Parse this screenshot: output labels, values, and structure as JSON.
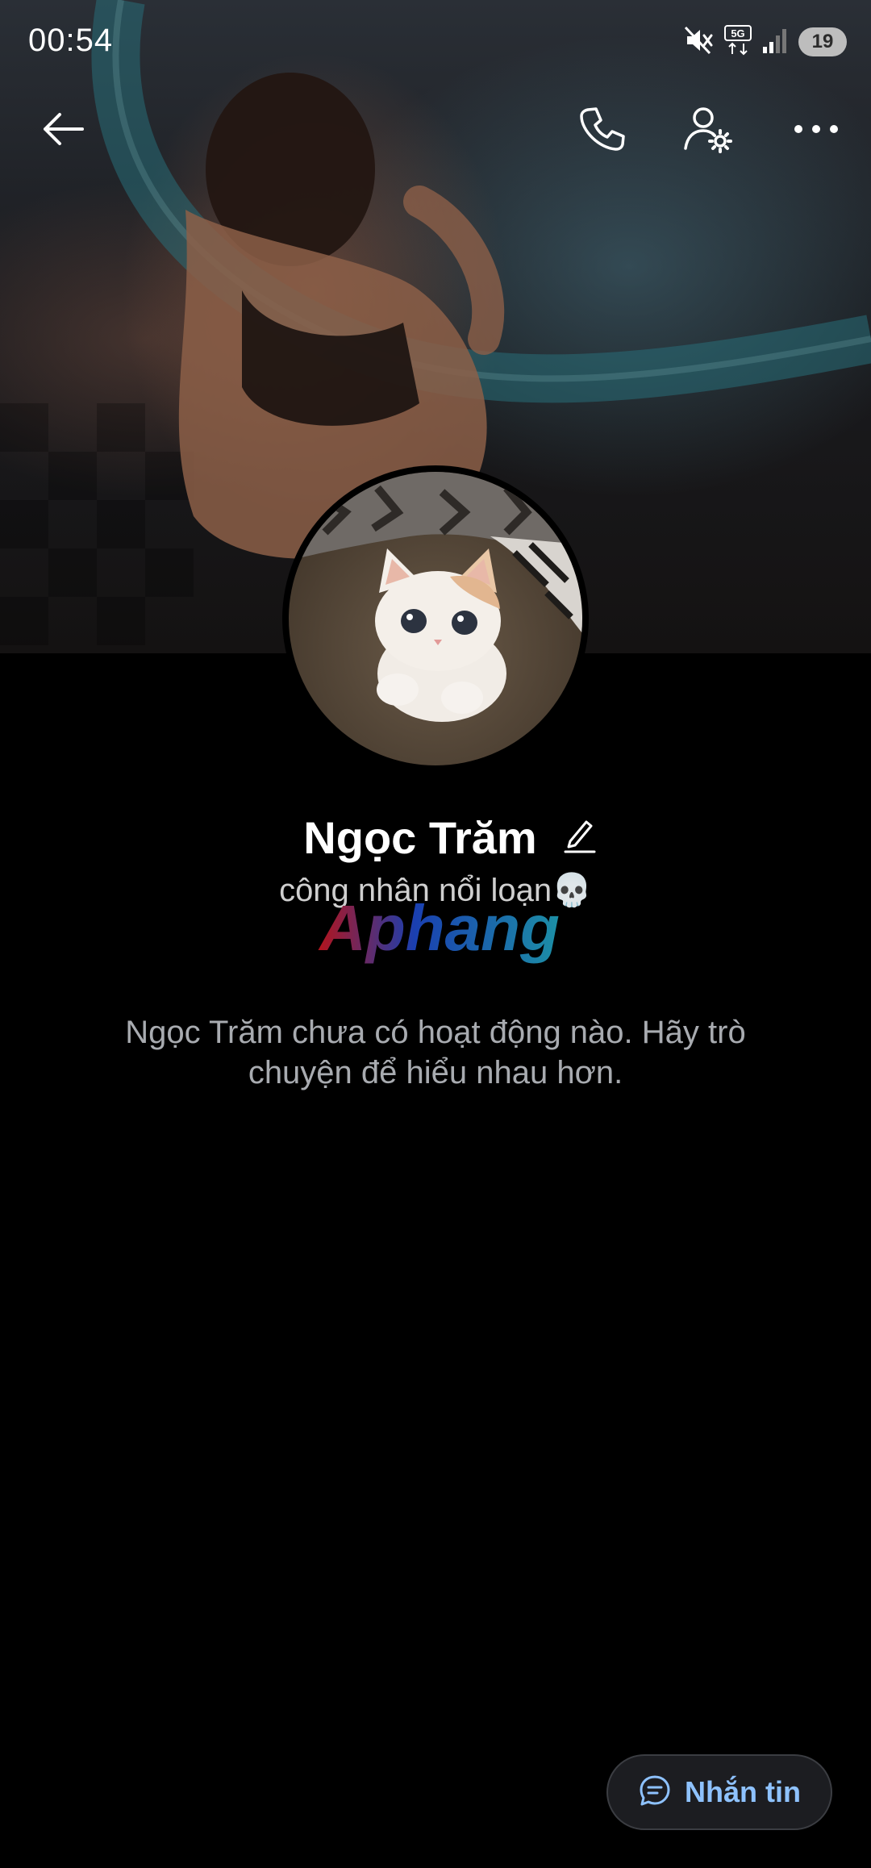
{
  "status_bar": {
    "time": "00:54",
    "network": "5G",
    "battery": "19"
  },
  "toolbar": {
    "back_icon": "arrow-left-icon",
    "call_icon": "phone-icon",
    "settings_icon": "user-settings-icon",
    "more_icon": "more-horizontal-icon"
  },
  "profile": {
    "name": "Ngọc Trăm",
    "bio": "công nhân nổi loạn💀",
    "watermark": "Aphang"
  },
  "activity": {
    "empty_message": "Ngọc Trăm chưa có hoạt động nào. Hãy trò chuyện để hiểu nhau hơn."
  },
  "actions": {
    "message_label": "Nhắn tin",
    "message_icon": "chat-bubble-icon"
  },
  "colors": {
    "background": "#000000",
    "accent": "#8ec2ff",
    "secondary_text": "#a8abb0",
    "button_bg": "#1c1d21"
  }
}
